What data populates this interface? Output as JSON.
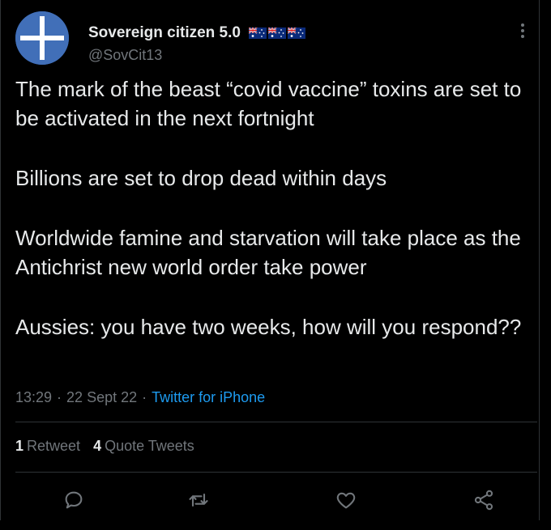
{
  "tweet": {
    "display_name": "Sovereign citizen 5.0",
    "handle": "@SovCit13",
    "flags": [
      "au-flag",
      "au-flag",
      "au-flag"
    ],
    "paragraphs": [
      "The mark of the beast “covid vaccine” toxins are set to be activated in the next fortnight",
      "Billions are set to drop dead within days",
      "Worldwide famine and starvation will take place as the Antichrist new world order take power",
      "Aussies: you have two weeks, how will you respond??"
    ],
    "time": "13:29",
    "date": "22 Sept 22",
    "separator": "·",
    "source": "Twitter for iPhone"
  },
  "stats": {
    "retweets_count": "1",
    "retweets_label": "Retweet",
    "quotes_count": "4",
    "quotes_label": "Quote Tweets"
  },
  "actions": [
    "reply-icon",
    "retweet-icon",
    "like-icon",
    "share-icon"
  ],
  "colors": {
    "background": "#000000",
    "text": "#e7e9ea",
    "muted": "#71767b",
    "link": "#1d9bf0",
    "divider": "#2f3336"
  }
}
